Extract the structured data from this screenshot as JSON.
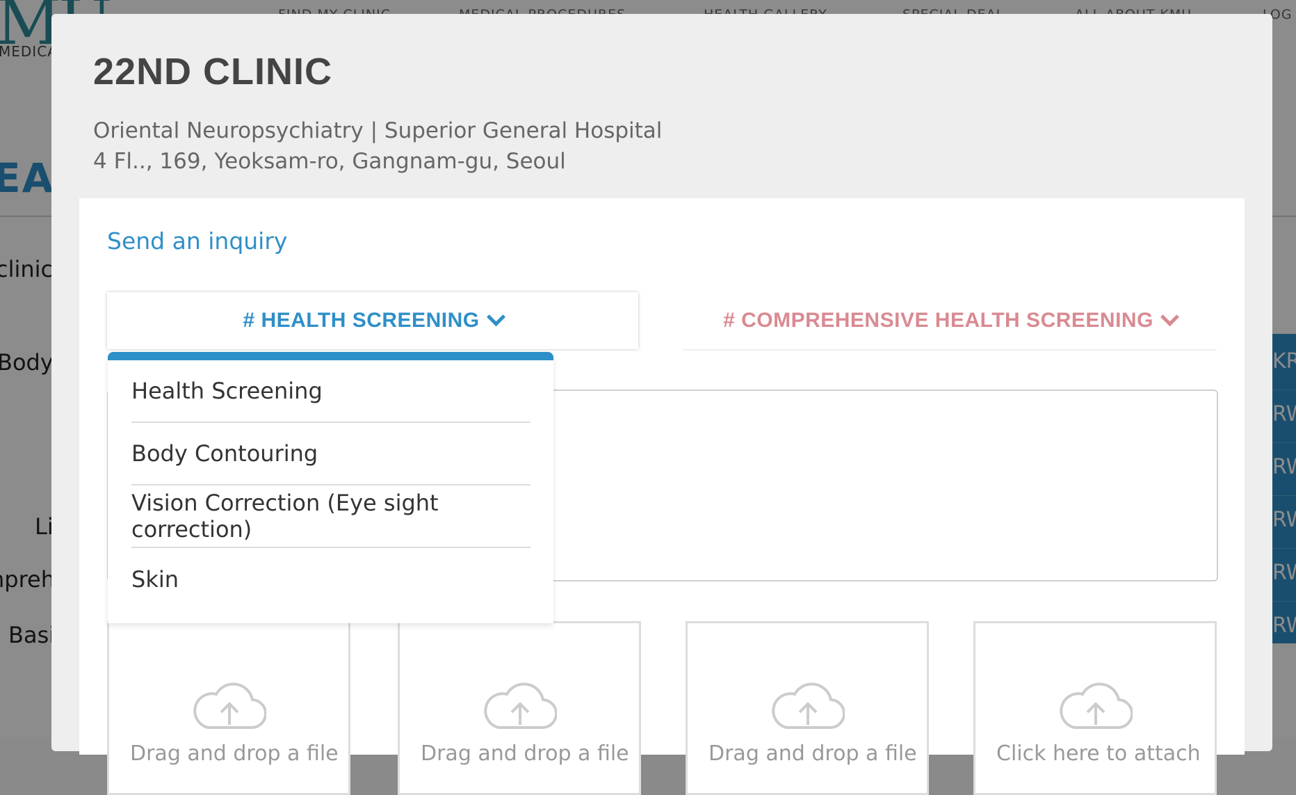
{
  "background": {
    "logo_mark": "MU",
    "logo_text": "MEDICAL",
    "nav": [
      "FIND MY CLINIC",
      "MEDICAL PROCEDURES",
      "HEALTH GALLERY",
      "SPECIAL DEAL",
      "ALL ABOUT KMU",
      "LOG"
    ],
    "heading": "EATI",
    "left_labels": [
      "clinic",
      "Body",
      "Li",
      "npreh",
      "Basi"
    ],
    "right_labels": [
      "KR\\",
      "RW",
      "RW",
      "RW",
      "RW",
      "RW"
    ]
  },
  "modal": {
    "clinic_name": "22ND CLINIC",
    "specialty_line": "Oriental Neuropsychiatry | Superior General Hospital",
    "address_line": "4 Fl.., 169, Yeoksam-ro, Gangnam-gu, Seoul",
    "inquiry_link": "Send an inquiry",
    "tabs": [
      {
        "label": "# HEALTH SCREENING",
        "color": "#2f8fc8",
        "active": true
      },
      {
        "label": "# COMPREHENSIVE HEALTH SCREENING",
        "color": "#d98a92",
        "active": false
      }
    ],
    "dropdown_items": [
      "Health Screening",
      "Body Contouring",
      "Vision Correction (Eye sight correction)",
      "Skin"
    ],
    "upload_boxes": [
      {
        "label": "Drag and drop a file",
        "icon": "cloud-upload-icon"
      },
      {
        "label": "Drag and drop a file",
        "icon": "cloud-upload-icon"
      },
      {
        "label": "Drag and drop a file",
        "icon": "cloud-upload-icon"
      },
      {
        "label": "Click here to attach",
        "icon": "cloud-upload-icon"
      }
    ]
  },
  "colors": {
    "accent": "#2f8fc8",
    "secondary": "#d98a92"
  }
}
